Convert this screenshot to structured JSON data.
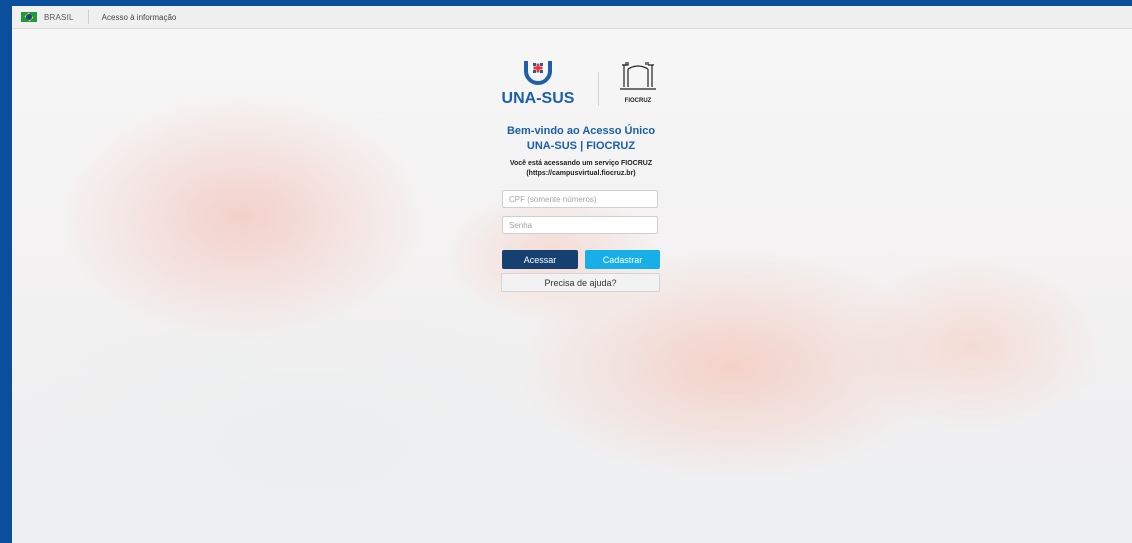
{
  "gov_bar": {
    "country": "BRASIL",
    "access_link": "Acesso à informação"
  },
  "logos": {
    "una_sus_text": "UNA-SUS",
    "fiocruz_text": "FIOCRUZ"
  },
  "login": {
    "welcome_line1": "Bem-vindo ao Acesso Único",
    "welcome_line2": "UNA-SUS | FIOCRUZ",
    "service_line1": "Você está acessando um serviço FIOCRUZ",
    "service_line2": "(https://campusvirtual.fiocruz.br)",
    "cpf_placeholder": "CPF (somente números)",
    "password_placeholder": "Senha",
    "login_button": "Acessar",
    "register_button": "Cadastrar",
    "help_button": "Precisa de ajuda?"
  },
  "colors": {
    "frame_blue": "#0b4f9c",
    "title_blue": "#1b5ea9",
    "primary_button": "#16406f",
    "secondary_button": "#18aee8"
  }
}
